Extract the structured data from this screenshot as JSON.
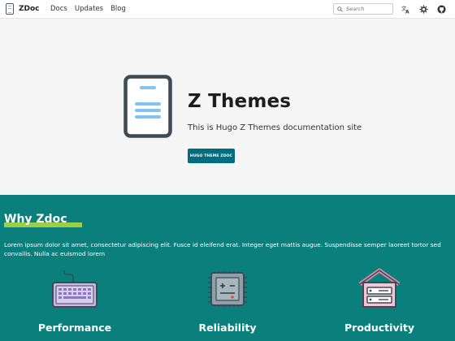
{
  "header": {
    "logo_text": "ZDoc",
    "links": [
      "Docs",
      "Updates",
      "Blog"
    ],
    "search_placeholder": "Search",
    "icons": [
      "translate-icon",
      "theme-toggle-icon",
      "github-icon"
    ]
  },
  "hero": {
    "title": "Z Themes",
    "subtitle": "This is Hugo Z Themes documentation site",
    "button_label": "HUGO THEME ZDOC"
  },
  "why": {
    "title": "Why Zdoc",
    "description": "Lorem ipsum dolor sit amet, consectetur adipiscing elit. Fusce id eleifend erat. Integer eget mattis augue. Suspendisse semper laoreet tortor sed convallis. Nulla ac euismod lorem",
    "features": [
      {
        "label": "Performance",
        "icon": "keyboard-icon"
      },
      {
        "label": "Reliability",
        "icon": "chip-icon"
      },
      {
        "label": "Productivity",
        "icon": "server-house-icon"
      }
    ]
  },
  "colors": {
    "accent": "#006d7e",
    "section_bg": "#0a7f7b",
    "highlight": "#9bcf48"
  }
}
